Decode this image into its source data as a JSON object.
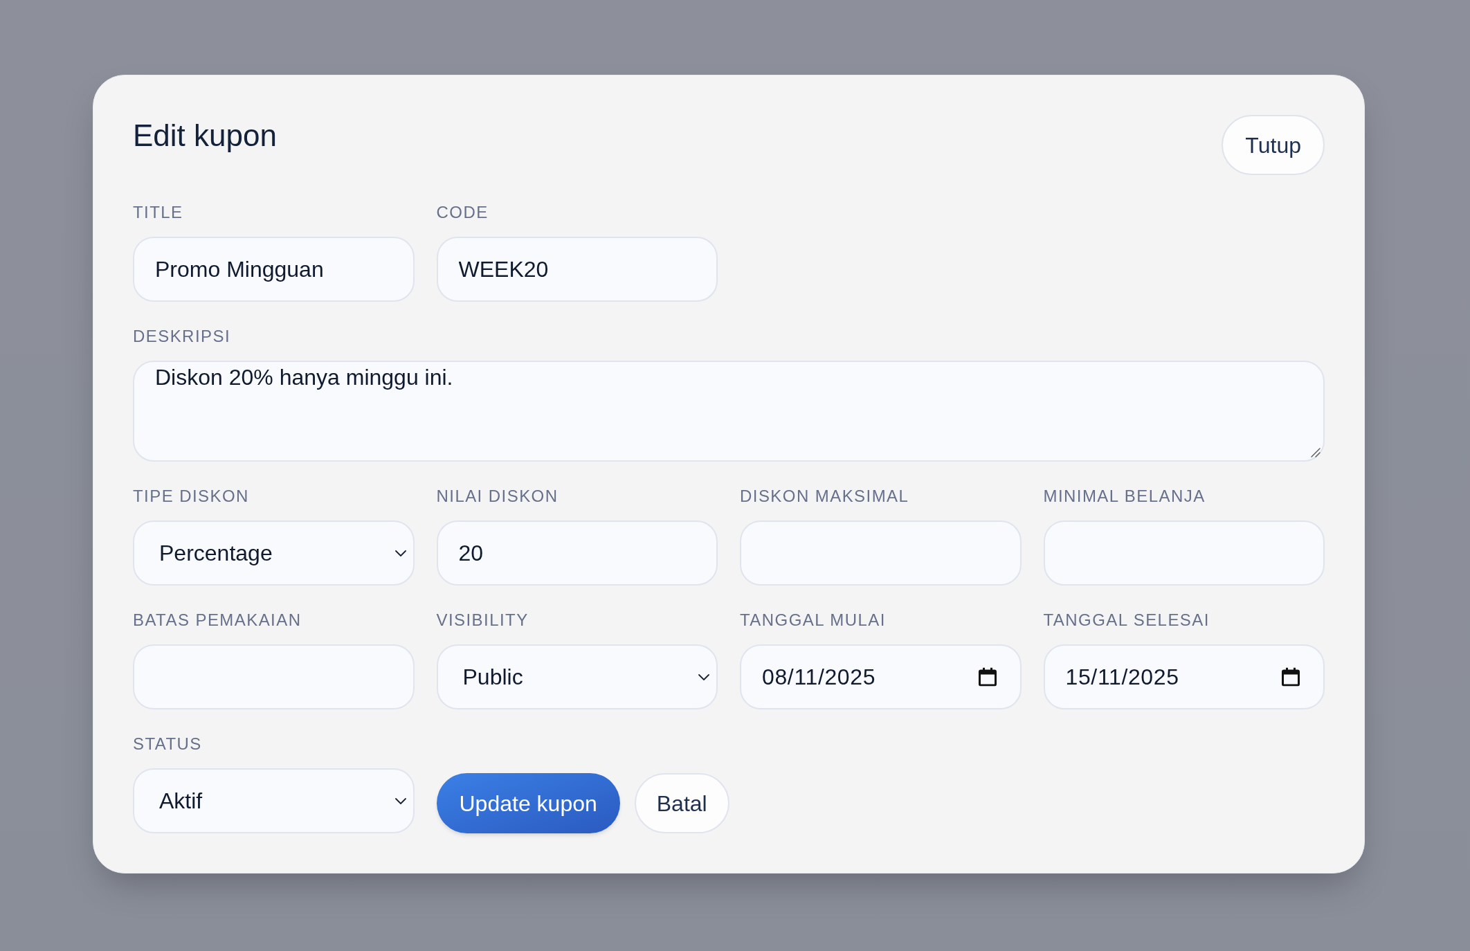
{
  "dialog": {
    "title": "Edit kupon",
    "close_button": {
      "label": "Tutup"
    }
  },
  "fields": [
    {
      "label": "TITLE",
      "kind": "text",
      "value": "Promo Mingguan"
    },
    {
      "label": "CODE",
      "kind": "text",
      "value": "WEEK20"
    },
    {
      "label": "DESKRIPSI",
      "kind": "textarea",
      "value": "Diskon 20% hanya minggu ini."
    },
    {
      "label": "TIPE DISKON",
      "kind": "select",
      "value": "Percentage"
    },
    {
      "label": "NILAI DISKON",
      "kind": "text",
      "value": "20"
    },
    {
      "label": "DISKON MAKSIMAL",
      "kind": "text"
    },
    {
      "label": "MINIMAL BELANJA",
      "kind": "text"
    },
    {
      "label": "BATAS PEMAKAIAN",
      "kind": "text"
    },
    {
      "label": "VISIBILITY",
      "kind": "select",
      "value": "Public"
    },
    {
      "label": "TANGGAL MULAI",
      "kind": "date",
      "value": "08/11/2025"
    },
    {
      "label": "TANGGAL SELESAI",
      "kind": "date",
      "value": "15/11/2025"
    },
    {
      "label": "STATUS",
      "kind": "select",
      "value": "Aktif"
    }
  ],
  "actions": [
    {
      "label": "Update kupon",
      "kind": "primary"
    },
    {
      "label": "Batal",
      "kind": "secondary"
    }
  ]
}
